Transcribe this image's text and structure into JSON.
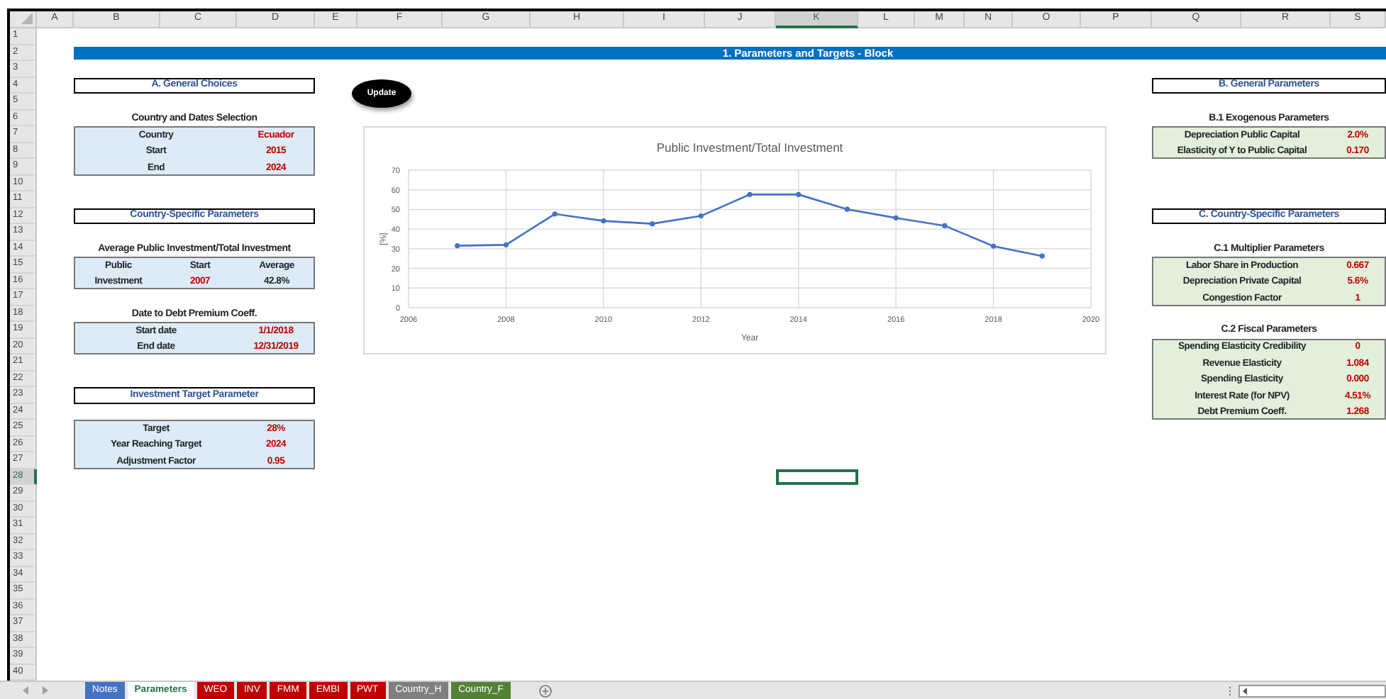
{
  "sheet": {
    "columns": [
      {
        "label": "A",
        "selected": false
      },
      {
        "label": "B",
        "selected": false
      },
      {
        "label": "C",
        "selected": false
      },
      {
        "label": "D",
        "selected": false
      },
      {
        "label": "E",
        "selected": false
      },
      {
        "label": "F",
        "selected": false
      },
      {
        "label": "G",
        "selected": false
      },
      {
        "label": "H",
        "selected": false
      },
      {
        "label": "I",
        "selected": false
      },
      {
        "label": "J",
        "selected": false
      },
      {
        "label": "K",
        "selected": true
      },
      {
        "label": "L",
        "selected": false
      },
      {
        "label": "M",
        "selected": false
      },
      {
        "label": "N",
        "selected": false
      },
      {
        "label": "O",
        "selected": false
      },
      {
        "label": "P",
        "selected": false
      },
      {
        "label": "Q",
        "selected": false
      },
      {
        "label": "R",
        "selected": false
      },
      {
        "label": "S",
        "selected": false
      }
    ],
    "rows": [
      {
        "label": "1",
        "selected": false
      },
      {
        "label": "2",
        "selected": false
      },
      {
        "label": "3",
        "selected": false
      },
      {
        "label": "4",
        "selected": false
      },
      {
        "label": "5",
        "selected": false
      },
      {
        "label": "6",
        "selected": false
      },
      {
        "label": "7",
        "selected": false
      },
      {
        "label": "8",
        "selected": false
      },
      {
        "label": "9",
        "selected": false
      },
      {
        "label": "10",
        "selected": false
      },
      {
        "label": "11",
        "selected": false
      },
      {
        "label": "12",
        "selected": false
      },
      {
        "label": "13",
        "selected": false
      },
      {
        "label": "14",
        "selected": false
      },
      {
        "label": "15",
        "selected": false
      },
      {
        "label": "16",
        "selected": false
      },
      {
        "label": "17",
        "selected": false
      },
      {
        "label": "18",
        "selected": false
      },
      {
        "label": "19",
        "selected": false
      },
      {
        "label": "20",
        "selected": false
      },
      {
        "label": "21",
        "selected": false
      },
      {
        "label": "22",
        "selected": false
      },
      {
        "label": "23",
        "selected": false
      },
      {
        "label": "24",
        "selected": false
      },
      {
        "label": "25",
        "selected": false
      },
      {
        "label": "26",
        "selected": false
      },
      {
        "label": "27",
        "selected": false
      },
      {
        "label": "28",
        "selected": true
      },
      {
        "label": "29",
        "selected": false
      },
      {
        "label": "30",
        "selected": false
      },
      {
        "label": "31",
        "selected": false
      },
      {
        "label": "32",
        "selected": false
      },
      {
        "label": "33",
        "selected": false
      },
      {
        "label": "34",
        "selected": false
      },
      {
        "label": "35",
        "selected": false
      },
      {
        "label": "36",
        "selected": false
      },
      {
        "label": "37",
        "selected": false
      },
      {
        "label": "38",
        "selected": false
      },
      {
        "label": "39",
        "selected": false
      },
      {
        "label": "40",
        "selected": false
      }
    ]
  },
  "banner": {
    "title": "1. Parameters and Targets - Block"
  },
  "update_button": {
    "label": "Update"
  },
  "left_sections": [
    {
      "heading": "A. General Choices",
      "groups": [
        {
          "subtitle": "Country and Dates Selection",
          "kind": "pairs",
          "rows": [
            {
              "label": "Country",
              "value": "Ecuador",
              "input": true
            },
            {
              "label": "Start",
              "value": "2015",
              "input": true
            },
            {
              "label": "End",
              "value": "2024",
              "input": true
            }
          ]
        }
      ]
    },
    {
      "heading": "Country-Specific Parameters",
      "groups": [
        {
          "subtitle": "Average Public Investment/Total Investment",
          "kind": "grid",
          "rows": [
            {
              "cells": [
                {
                  "text": "Public",
                  "input": false
                },
                {
                  "text": "Start",
                  "input": false
                },
                {
                  "text": "Average",
                  "input": false
                }
              ]
            },
            {
              "cells": [
                {
                  "text": "Investment",
                  "input": false
                },
                {
                  "text": "2007",
                  "input": true
                },
                {
                  "text": "42.8%",
                  "input": false
                }
              ]
            }
          ]
        },
        {
          "subtitle": "Date to Debt Premium Coeff.",
          "kind": "pairs",
          "rows": [
            {
              "label": "Start date",
              "value": "1/1/2018",
              "input": true
            },
            {
              "label": "End date",
              "value": "12/31/2019",
              "input": true
            }
          ]
        }
      ]
    },
    {
      "heading": "Investment Target Parameter",
      "groups": [
        {
          "kind": "pairs",
          "rows": [
            {
              "label": "Target",
              "value": "28%",
              "input": true
            },
            {
              "label": "Year Reaching Target",
              "value": "2024",
              "input": true
            },
            {
              "label": "Adjustment Factor",
              "value": "0.95",
              "input": true
            }
          ]
        }
      ]
    }
  ],
  "right_sections": [
    {
      "heading": "B. General Parameters",
      "groups": [
        {
          "subtitle": "B.1 Exogenous Parameters",
          "kind": "pairs",
          "rows": [
            {
              "label": "Depreciation Public Capital",
              "value": "2.0%",
              "input": true
            },
            {
              "label": "Elasticity of Y to Public Capital",
              "value": "0.170",
              "input": true
            }
          ]
        }
      ]
    },
    {
      "heading": "C. Country-Specific Parameters",
      "groups": [
        {
          "subtitle": "C.1 Multiplier Parameters",
          "kind": "pairs",
          "rows": [
            {
              "label": "Labor Share in Production",
              "value": "0.667",
              "input": true
            },
            {
              "label": "Depreciation Private Capital",
              "value": "5.6%",
              "input": true
            },
            {
              "label": "Congestion Factor",
              "value": "1",
              "input": true
            }
          ]
        },
        {
          "subtitle": "C.2 Fiscal Parameters",
          "kind": "pairs",
          "rows": [
            {
              "label": "Spending Elasticity Credibility",
              "value": "0",
              "input": true
            },
            {
              "label": "Revenue Elasticity",
              "value": "1.084",
              "input": true
            },
            {
              "label": "Spending Elasticity",
              "value": "0.000",
              "input": true
            },
            {
              "label": "Interest Rate (for NPV)",
              "value": "4.51%",
              "input": true
            },
            {
              "label": "Debt Premium Coeff.",
              "value": "1.268",
              "input": true
            }
          ]
        }
      ]
    }
  ],
  "chart": {
    "chart_data": {
      "type": "line",
      "title": "Public Investment/Total Investment",
      "xlabel": "Year",
      "ylabel": "[%]",
      "x": [
        2007,
        2008,
        2009,
        2010,
        2011,
        2012,
        2013,
        2014,
        2015,
        2016,
        2017,
        2018,
        2019
      ],
      "grid": true,
      "series": [
        {
          "color": "#4472c4",
          "marker": "circle",
          "values": [
            31.5,
            32.0,
            47.7,
            44.2,
            42.7,
            46.7,
            57.6,
            57.6,
            50.1,
            45.7,
            41.7,
            31.3,
            26.3
          ]
        }
      ],
      "xlim": [
        2006,
        2020
      ],
      "ylim": [
        0,
        70
      ],
      "xticks": [
        2006,
        2008,
        2010,
        2012,
        2014,
        2016,
        2018,
        2020
      ],
      "yticks": [
        0,
        10,
        20,
        30,
        40,
        50,
        60,
        70
      ]
    }
  },
  "tabs": [
    {
      "label": "Notes",
      "selected": false,
      "color": "#4472c4"
    },
    {
      "label": "Parameters",
      "selected": true
    },
    {
      "label": "WEO",
      "selected": false,
      "color": "#c00000"
    },
    {
      "label": "INV",
      "selected": false,
      "color": "#c00000"
    },
    {
      "label": "FMM",
      "selected": false,
      "color": "#c00000"
    },
    {
      "label": "EMBI",
      "selected": false,
      "color": "#c00000"
    },
    {
      "label": "PWT",
      "selected": false,
      "color": "#c00000"
    },
    {
      "label": "Country_H",
      "selected": false,
      "color": "#808080"
    },
    {
      "label": "Country_F",
      "selected": false,
      "color": "#548235"
    }
  ]
}
